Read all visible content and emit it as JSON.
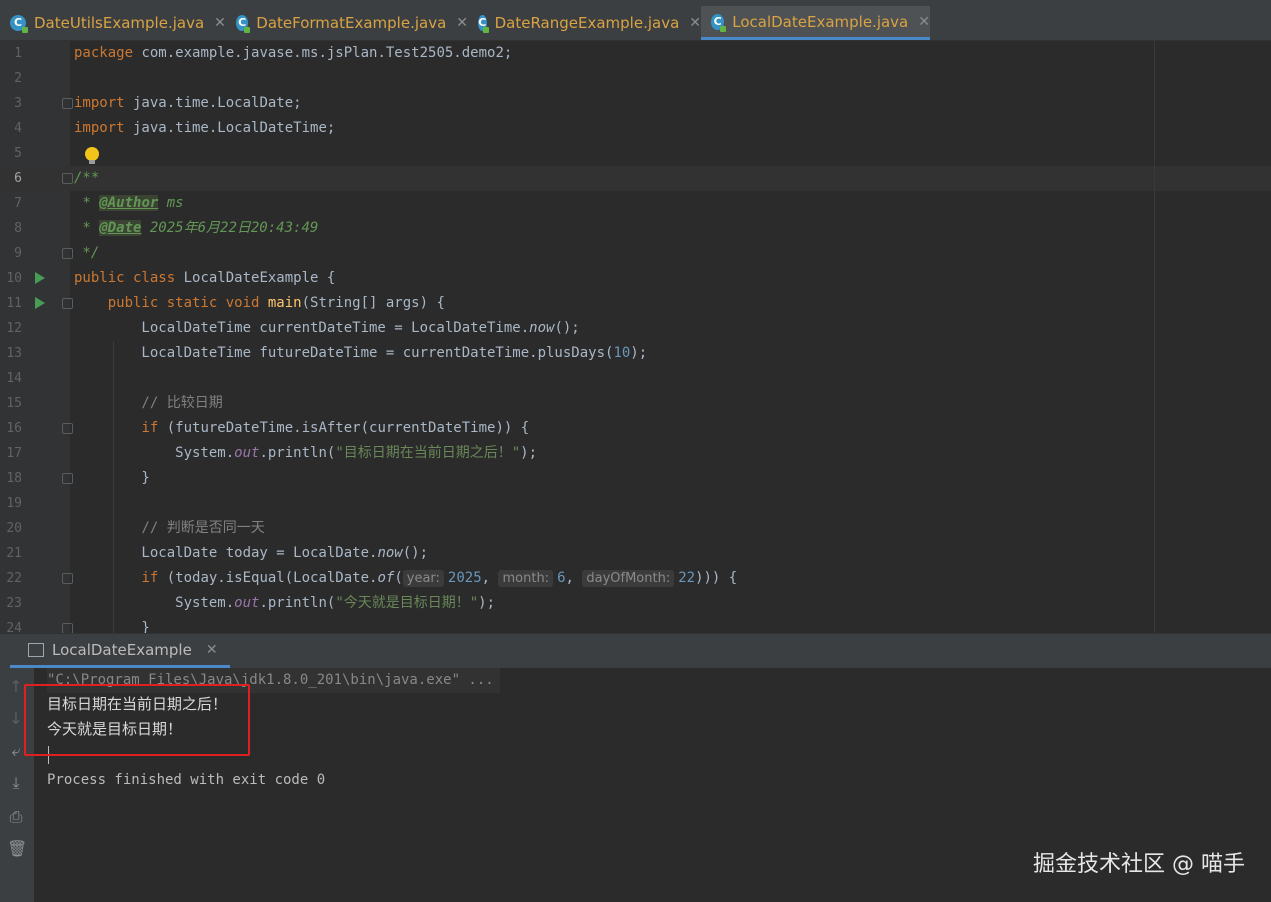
{
  "tabs": [
    {
      "label": "DateUtilsExample.java",
      "active": false
    },
    {
      "label": "DateFormatExample.java",
      "active": false
    },
    {
      "label": "DateRangeExample.java",
      "active": false
    },
    {
      "label": "LocalDateExample.java",
      "active": true
    }
  ],
  "editor": {
    "line_numbers": [
      "1",
      "2",
      "3",
      "4",
      "5",
      "6",
      "7",
      "8",
      "9",
      "10",
      "11",
      "12",
      "13",
      "14",
      "15",
      "16",
      "17",
      "18",
      "19",
      "20",
      "21",
      "22",
      "23",
      "24"
    ],
    "code": {
      "l1_kw": "package",
      "l1_rest": " com.example.javase.ms.jsPlan.Test2505.demo2;",
      "l3_kw": "import",
      "l3_rest": " java.time.LocalDate;",
      "l4_kw": "import",
      "l4_rest": " java.time.LocalDateTime;",
      "l6": "/**",
      "l7_star": " * ",
      "l7_tag": "@Author",
      "l7_val": " ms",
      "l8_star": " * ",
      "l8_tag": "@Date",
      "l8_val": " 2025年6月22日20:43:49",
      "l9": " */",
      "l10_kw": "public class",
      "l10_rest": " LocalDateExample {",
      "l11_indent": "    ",
      "l11_kw": "public static void",
      "l11_sp": " ",
      "l11_fn": "main",
      "l11_rest": "(String[] args) {",
      "l12_a": "        LocalDateTime currentDateTime = LocalDateTime.",
      "l12_b": "now",
      "l12_c": "();",
      "l13_a": "        LocalDateTime futureDateTime = currentDateTime.plusDays(",
      "l13_num": "10",
      "l13_c": ");",
      "l15": "        // 比较日期",
      "l16_indent": "        ",
      "l16_kw": "if",
      "l16_rest": " (futureDateTime.isAfter(currentDateTime)) {",
      "l17_a": "            System.",
      "l17_fld": "out",
      "l17_b": ".println(",
      "l17_str": "\"目标日期在当前日期之后！\"",
      "l17_c": ");",
      "l18": "        }",
      "l20": "        // 判断是否同一天",
      "l21_a": "        LocalDate today = LocalDate.",
      "l21_b": "now",
      "l21_c": "();",
      "l22_indent": "        ",
      "l22_kw": "if",
      "l22_a": " (today.isEqual(LocalDate.",
      "l22_of": "of",
      "l22_p": "(",
      "l22_h1": "year:",
      "l22_n1": "2025",
      "l22_comma1": ", ",
      "l22_h2": "month:",
      "l22_n2": "6",
      "l22_comma2": ", ",
      "l22_h3": "dayOfMonth:",
      "l22_n3": "22",
      "l22_end": "))) {",
      "l23_a": "            System.",
      "l23_fld": "out",
      "l23_b": ".println(",
      "l23_str": "\"今天就是目标日期！\"",
      "l23_c": ");",
      "l24": "        }"
    }
  },
  "run_panel": {
    "tab_label": "LocalDateExample",
    "command": "\"C:\\Program Files\\Java\\jdk1.8.0_201\\bin\\java.exe\" ...",
    "output": [
      "目标日期在当前日期之后！",
      "今天就是目标日期！"
    ],
    "exit_message": "Process finished with exit code 0"
  },
  "watermark": "掘金技术社区 @ 喵手",
  "colors": {
    "accent": "#4a88c7",
    "keyword": "#cc7832",
    "string": "#6a8759",
    "number": "#6897bb",
    "highlight_box": "#e02020"
  },
  "icons": [
    "java-class-icon",
    "run-gutter-icon",
    "lightbulb-icon",
    "console-window-icon",
    "arrow-up-icon",
    "arrow-down-icon",
    "soft-wrap-icon",
    "scroll-to-end-icon",
    "print-icon",
    "trash-icon"
  ]
}
